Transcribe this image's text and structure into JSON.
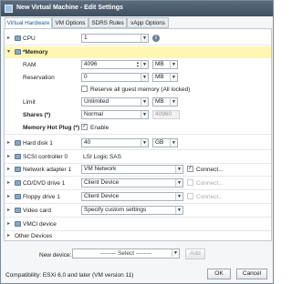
{
  "window": {
    "title": "New Virtual Machine - Edit Settings"
  },
  "tabs": [
    "Virtual Hardware",
    "VM Options",
    "SDRS Rules",
    "vApp Options"
  ],
  "cpu": {
    "label": "CPU",
    "value": "1",
    "info_icon": "info-icon"
  },
  "memory": {
    "label": "*Memory",
    "ram_label": "RAM",
    "ram_value": "4096",
    "ram_unit": "MB",
    "reservation_label": "Reservation",
    "reservation_value": "0",
    "reservation_unit": "MB",
    "reserve_all_label": "Reserve all guest memory (All locked)",
    "limit_label": "Limit",
    "limit_value": "Unlimited",
    "limit_unit": "MB",
    "shares_label": "Shares (*)",
    "shares_value": "Normal",
    "shares_number": "40960",
    "hotplug_label": "Memory Hot Plug (*)",
    "hotplug_enable_label": "Enable"
  },
  "hard_disk": {
    "label": "Hard disk 1",
    "value": "40",
    "unit": "GB"
  },
  "scsi": {
    "label": "SCSI controller 0",
    "value": "LSI Logic SAS"
  },
  "network": {
    "label": "Network adapter 1",
    "value": "VM Network",
    "connect_label": "Connect..."
  },
  "cddvd": {
    "label": "CD/DVD drive 1",
    "value": "Client Device",
    "connect_label": "Connect..."
  },
  "floppy": {
    "label": "Floppy drive 1",
    "value": "Client Device",
    "connect_label": "Connect..."
  },
  "video": {
    "label": "Video card",
    "value": "Specify custom settings"
  },
  "vmci": {
    "label": "VMCI device"
  },
  "other": {
    "label": "Other Devices"
  },
  "new_device": {
    "label": "New device:",
    "value": "-------- Select --------",
    "add_label": "Add"
  },
  "footer": {
    "compatibility": "Compatibility: ESXi 6.0 and later (VM version 11)",
    "ok_label": "OK",
    "cancel_label": "Cancel"
  }
}
